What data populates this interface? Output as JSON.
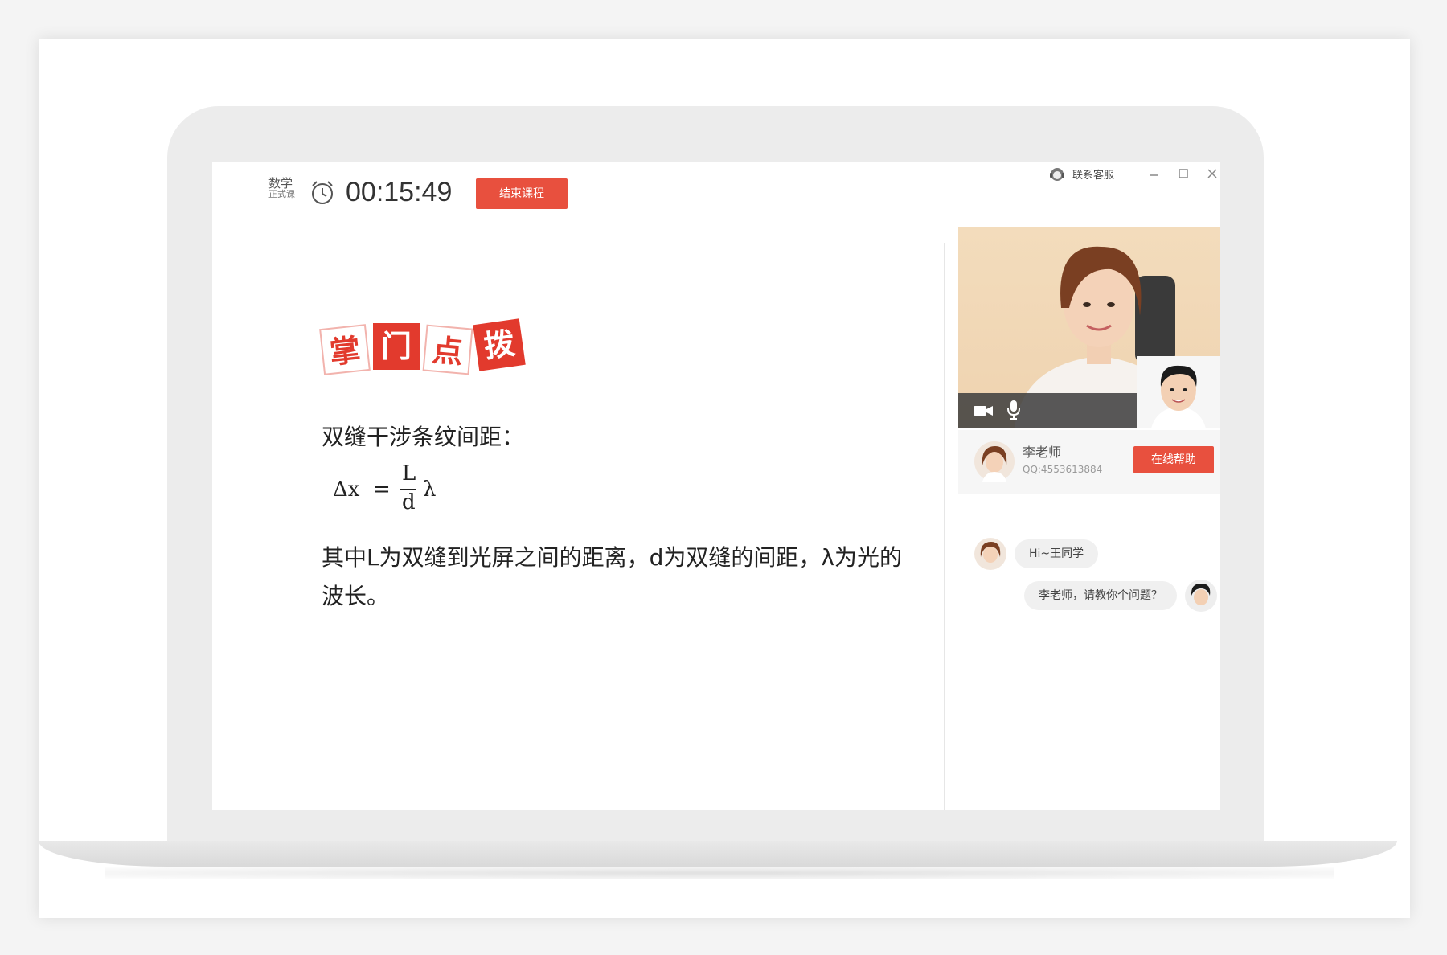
{
  "header": {
    "subject": "数学",
    "subject_sub": "正式课",
    "timer": "00:15:49",
    "end_button": "结束课程",
    "service": "联系客服"
  },
  "lesson": {
    "stamp_chars": [
      "掌",
      "门",
      "点",
      "拨"
    ],
    "formula_title": "双缝干涉条纹间距：",
    "formula": {
      "lhs": "Δx",
      "eq": "=",
      "numerator": "L",
      "denominator": "d",
      "tail": "λ"
    },
    "explanation": "其中L为双缝到光屏之间的距离，d为双缝的间距，λ为光的波长。"
  },
  "teacher": {
    "name": "李老师",
    "qq": "QQ:4553613884",
    "help_button": "在线帮助"
  },
  "chat": [
    {
      "from": "teacher",
      "text": "Hi~王同学"
    },
    {
      "from": "student",
      "text": "李老师，请教你个问题？"
    }
  ],
  "colors": {
    "accent": "#e8503e",
    "stamp_red": "#e23a2d"
  }
}
